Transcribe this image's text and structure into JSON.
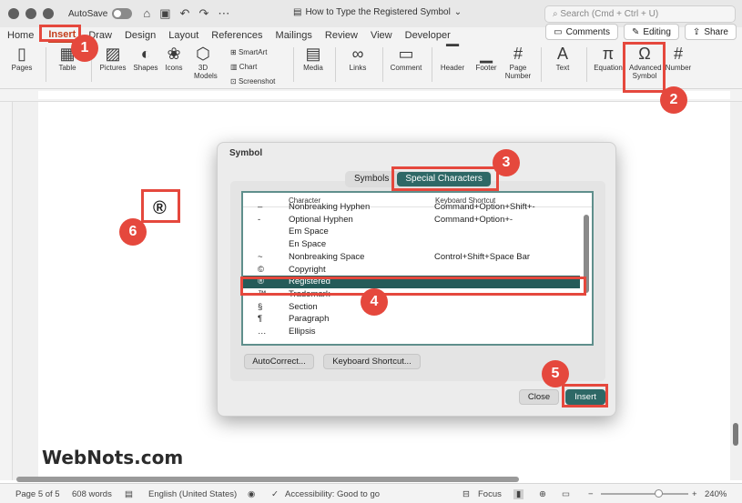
{
  "titlebar": {
    "autosave_label": "AutoSave",
    "document_title": "How to Type the Registered Symbol",
    "search_placeholder": "Search (Cmd + Ctrl + U)"
  },
  "ribbon_tabs": [
    "Home",
    "Insert",
    "Draw",
    "Design",
    "Layout",
    "References",
    "Mailings",
    "Review",
    "View",
    "Developer"
  ],
  "active_tab": "Insert",
  "top_buttons": {
    "comments": "Comments",
    "editing": "Editing",
    "share": "Share"
  },
  "ribbon_groups": {
    "pages": "Pages",
    "table": "Table",
    "pictures": "Pictures",
    "shapes": "Shapes",
    "icons": "Icons",
    "models_3d": "3D Models",
    "smartart": "SmartArt",
    "chart": "Chart",
    "screenshot": "Screenshot",
    "media": "Media",
    "links": "Links",
    "comment": "Comment",
    "header": "Header",
    "footer": "Footer",
    "page_number": "Page Number",
    "text": "Text",
    "equation": "Equation",
    "advanced_symbol": "Advanced Symbol",
    "number": "Number"
  },
  "document": {
    "symbol_text": "®"
  },
  "dialog": {
    "title": "Symbol",
    "tabs": [
      "Symbols",
      "Special Characters"
    ],
    "active_tab": "Special Characters",
    "columns": [
      "Character",
      "Keyboard Shortcut"
    ],
    "rows": [
      {
        "glyph": "–",
        "name": "Nonbreaking Hyphen",
        "shortcut": "Command+Option+Shift+-"
      },
      {
        "glyph": "-",
        "name": "Optional Hyphen",
        "shortcut": "Command+Option+-"
      },
      {
        "glyph": "",
        "name": "Em Space",
        "shortcut": ""
      },
      {
        "glyph": "",
        "name": "En Space",
        "shortcut": ""
      },
      {
        "glyph": "~",
        "name": "Nonbreaking Space",
        "shortcut": "Control+Shift+Space Bar"
      },
      {
        "glyph": "©",
        "name": "Copyright",
        "shortcut": ""
      },
      {
        "glyph": "®",
        "name": "Registered",
        "shortcut": ""
      },
      {
        "glyph": "™",
        "name": "Trademark",
        "shortcut": ""
      },
      {
        "glyph": "§",
        "name": "Section",
        "shortcut": ""
      },
      {
        "glyph": "¶",
        "name": "Paragraph",
        "shortcut": ""
      },
      {
        "glyph": "…",
        "name": "Ellipsis",
        "shortcut": ""
      }
    ],
    "selected_row": "Registered",
    "autocorrect_button": "AutoCorrect...",
    "keyboard_shortcut_button": "Keyboard Shortcut...",
    "close_button": "Close",
    "insert_button": "Insert"
  },
  "callouts": [
    "1",
    "2",
    "3",
    "4",
    "5",
    "6"
  ],
  "watermark": "WebNots.com",
  "statusbar": {
    "page": "Page 5 of 5",
    "words": "608 words",
    "language": "English (United States)",
    "accessibility": "Accessibility: Good to go",
    "focus": "Focus",
    "zoom": "240%"
  },
  "colors": {
    "accent_red": "#e5483d",
    "dialog_teal": "#2e6866",
    "insert_tab": "#c43e1c"
  }
}
